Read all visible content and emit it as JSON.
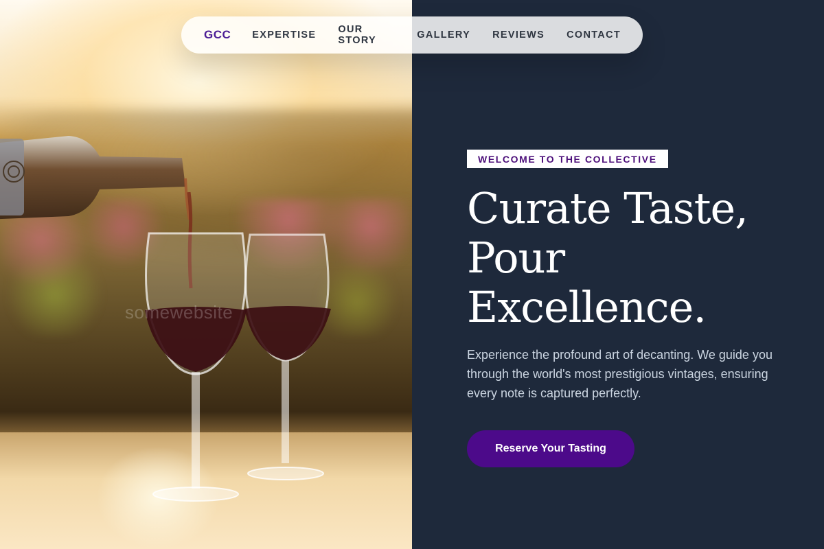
{
  "nav": {
    "brand": "GCC",
    "links": [
      "EXPERTISE",
      "OUR STORY",
      "GALLERY",
      "REVIEWS",
      "CONTACT"
    ]
  },
  "hero": {
    "eyebrow": "WELCOME TO THE COLLECTIVE",
    "title_lines": [
      "Curate Taste,",
      "Pour",
      "Excellence."
    ],
    "description": "Experience the profound art of decanting. We guide you through the world's most prestigious vintages, ensuring every note is captured perfectly.",
    "cta_label": "Reserve Your Tasting",
    "image_watermark": "somewebsite"
  },
  "colors": {
    "accent": "#4c0a8a",
    "brand": "#4c1d95",
    "panel_bg": "#1e293b",
    "body_text": "#cbd5e1"
  }
}
